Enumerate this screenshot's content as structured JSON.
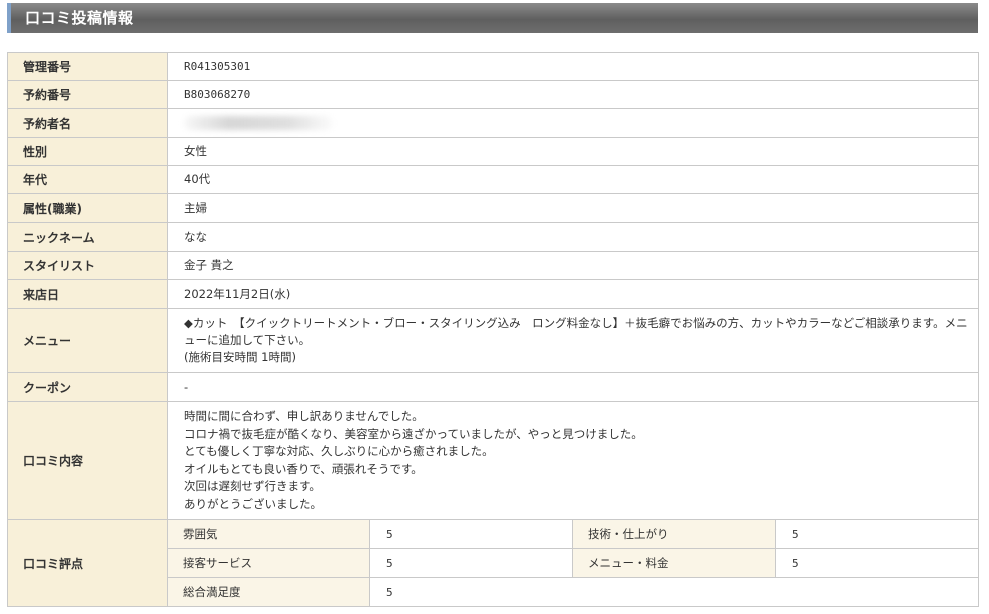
{
  "header": {
    "title": "口コミ投稿情報"
  },
  "info": {
    "management_number": {
      "label": "管理番号",
      "value": "R041305301"
    },
    "reservation_number": {
      "label": "予約番号",
      "value": "B803068270"
    },
    "reserver_name": {
      "label": "予約者名",
      "value": ""
    },
    "gender": {
      "label": "性別",
      "value": "女性"
    },
    "age": {
      "label": "年代",
      "value": "40代"
    },
    "occupation": {
      "label": "属性(職業)",
      "value": "主婦"
    },
    "nickname": {
      "label": "ニックネーム",
      "value": "なな"
    },
    "stylist": {
      "label": "スタイリスト",
      "value": "金子 貴之"
    },
    "visit_date": {
      "label": "来店日",
      "value": "2022年11月2日(水)"
    },
    "menu": {
      "label": "メニュー",
      "line1": "◆カット　【クイックトリートメント・ブロー・スタイリング込み　ロング料金なし】＋抜毛癖でお悩みの方、カットやカラーなどご相談承ります。メニューに追加して下さい。",
      "line2": "(施術目安時間 1時間)"
    },
    "coupon": {
      "label": "クーポン",
      "value": "-"
    },
    "review": {
      "label": "口コミ内容",
      "lines": [
        "時間に間に合わず、申し訳ありませんでした。",
        "コロナ禍で抜毛症が酷くなり、美容室から遠ざかっていましたが、やっと見つけました。",
        "とても優しく丁寧な対応、久しぶりに心から癒されました。",
        "オイルもとても良い香りで、頑張れそうです。",
        "次回は遅刻せず行きます。",
        "ありがとうございました。"
      ]
    },
    "scores": {
      "label": "口コミ評点",
      "atmosphere": {
        "label": "雰囲気",
        "value": "5"
      },
      "technique": {
        "label": "技術・仕上がり",
        "value": "5"
      },
      "service": {
        "label": "接客サービス",
        "value": "5"
      },
      "menu_price": {
        "label": "メニュー・料金",
        "value": "5"
      },
      "overall": {
        "label": "総合満足度",
        "value": "5"
      }
    }
  }
}
